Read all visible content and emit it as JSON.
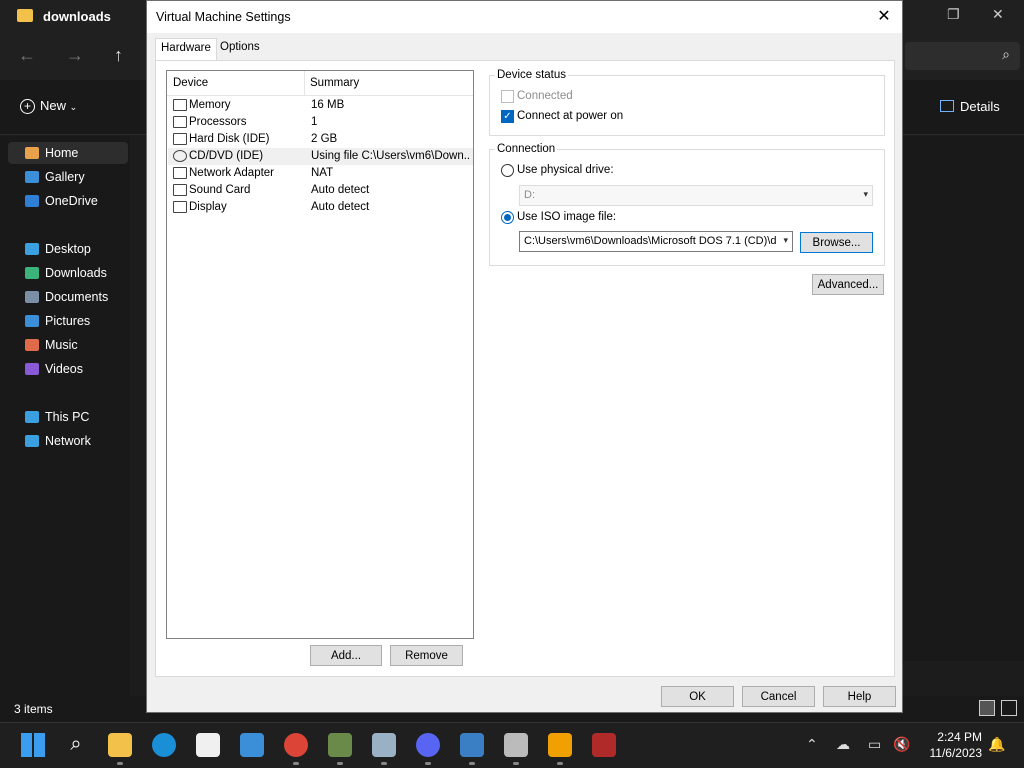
{
  "explorer": {
    "title": "downloads",
    "new_label": "New",
    "details_label": "Details",
    "sidebar": [
      {
        "label": "Home",
        "icon": "home-icon",
        "color": "#e8a24b"
      },
      {
        "label": "Gallery",
        "icon": "gallery-icon",
        "color": "#3a8fd8"
      },
      {
        "label": "OneDrive",
        "icon": "cloud-icon",
        "color": "#2f7fd6"
      },
      {
        "label": "Desktop",
        "icon": "desktop-icon",
        "color": "#3aa0e0"
      },
      {
        "label": "Downloads",
        "icon": "download-icon",
        "color": "#3bb37a"
      },
      {
        "label": "Documents",
        "icon": "document-icon",
        "color": "#7a8fa6"
      },
      {
        "label": "Pictures",
        "icon": "pictures-icon",
        "color": "#3a8fd8"
      },
      {
        "label": "Music",
        "icon": "music-icon",
        "color": "#e06b4a"
      },
      {
        "label": "Videos",
        "icon": "videos-icon",
        "color": "#8a5ad6"
      },
      {
        "label": "This PC",
        "icon": "pc-icon",
        "color": "#3aa0e0"
      },
      {
        "label": "Network",
        "icon": "network-icon",
        "color": "#3aa0e0"
      }
    ],
    "status_count": "3 items"
  },
  "dialog": {
    "title": "Virtual Machine Settings",
    "tabs": [
      "Hardware",
      "Options"
    ],
    "columns": {
      "device": "Device",
      "summary": "Summary"
    },
    "devices": [
      {
        "name": "Memory",
        "summary": "16 MB",
        "icon": "memory-icon"
      },
      {
        "name": "Processors",
        "summary": "1",
        "icon": "processor-icon"
      },
      {
        "name": "Hard Disk (IDE)",
        "summary": "2 GB",
        "icon": "harddisk-icon"
      },
      {
        "name": "CD/DVD (IDE)",
        "summary": "Using file C:\\Users\\vm6\\Down...",
        "icon": "cdrom-icon"
      },
      {
        "name": "Network Adapter",
        "summary": "NAT",
        "icon": "network-adapter-icon"
      },
      {
        "name": "Sound Card",
        "summary": "Auto detect",
        "icon": "sound-icon"
      },
      {
        "name": "Display",
        "summary": "Auto detect",
        "icon": "display-icon"
      }
    ],
    "add_label": "Add...",
    "remove_label": "Remove",
    "device_status": {
      "label": "Device status",
      "connected_label": "Connected",
      "connected_checked": false,
      "power_on_label": "Connect at power on",
      "power_on_checked": true
    },
    "connection": {
      "label": "Connection",
      "physical_label": "Use physical drive:",
      "physical_value": "D:",
      "iso_label": "Use ISO image file:",
      "iso_value": "C:\\Users\\vm6\\Downloads\\Microsoft DOS 7.1 (CD)\\d",
      "browse_label": "Browse..."
    },
    "advanced_label": "Advanced...",
    "ok_label": "OK",
    "cancel_label": "Cancel",
    "help_label": "Help"
  },
  "taskbar": {
    "time": "2:24 PM",
    "date": "11/6/2023"
  }
}
